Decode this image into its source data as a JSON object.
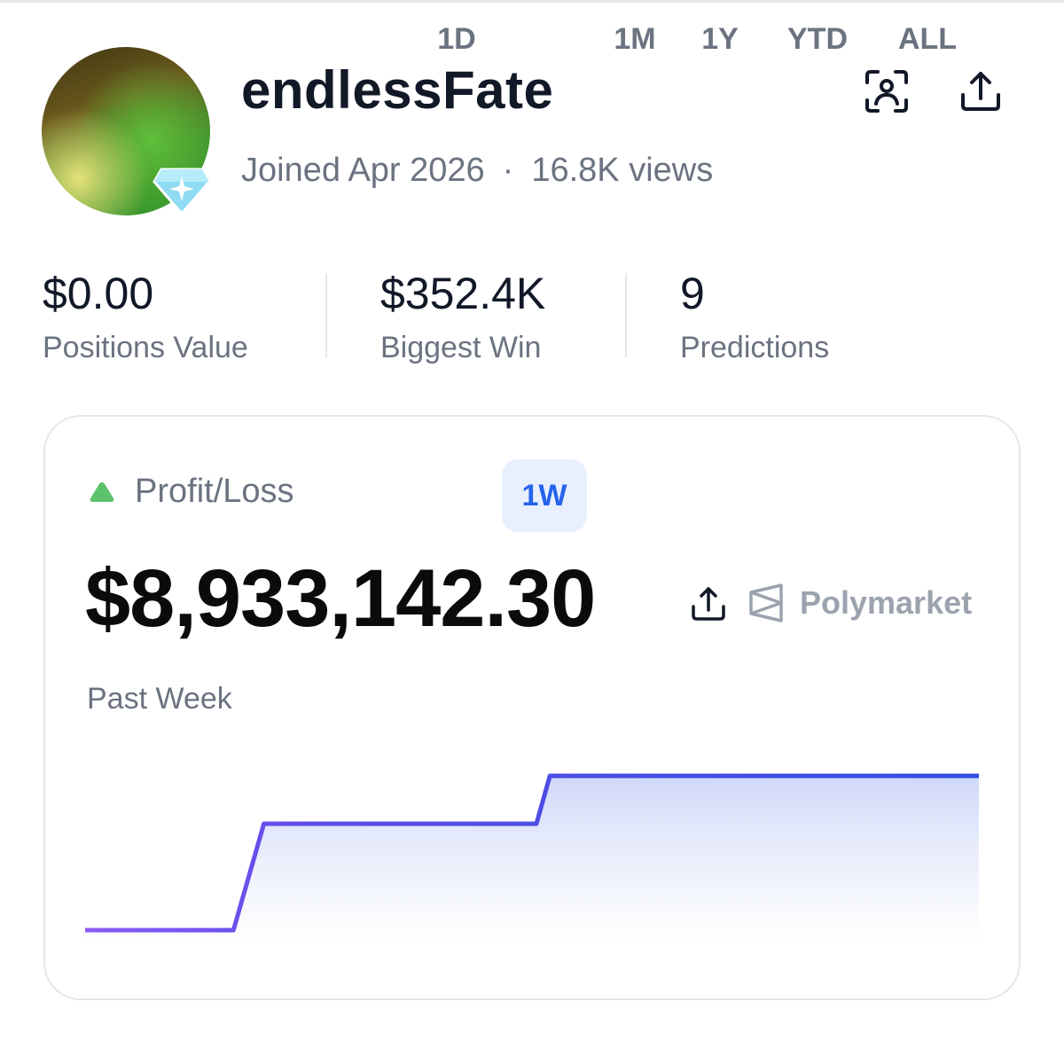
{
  "profile": {
    "username": "endlessFate",
    "joined": "Joined Apr 2026",
    "separator": "·",
    "views": "16.8K views"
  },
  "header_icons": [
    "face-scan-icon",
    "share-icon"
  ],
  "stats": [
    {
      "value": "$0.00",
      "label": "Positions Value"
    },
    {
      "value": "$352.4K",
      "label": "Biggest Win"
    },
    {
      "value": "9",
      "label": "Predictions"
    }
  ],
  "pnl": {
    "label": "Profit/Loss",
    "indicator_color": "#5cc26b",
    "tabs": [
      "1D",
      "1W",
      "1M",
      "1Y",
      "YTD",
      "ALL"
    ],
    "active_tab": "1W",
    "value": "$8,933,142.30",
    "brand": "Polymarket",
    "period": "Past Week",
    "accent": "#2563eb"
  },
  "chart_data": {
    "type": "line",
    "x": [
      0,
      0.166,
      0.2,
      0.49,
      0.505,
      0.52,
      1.0
    ],
    "y": [
      0,
      0,
      0.6,
      0.6,
      0.6,
      0.87,
      0.87
    ],
    "xlabel": "",
    "ylabel": "",
    "grid": false,
    "colors": [
      "#8b5cf6",
      "#2f4de0"
    ]
  }
}
